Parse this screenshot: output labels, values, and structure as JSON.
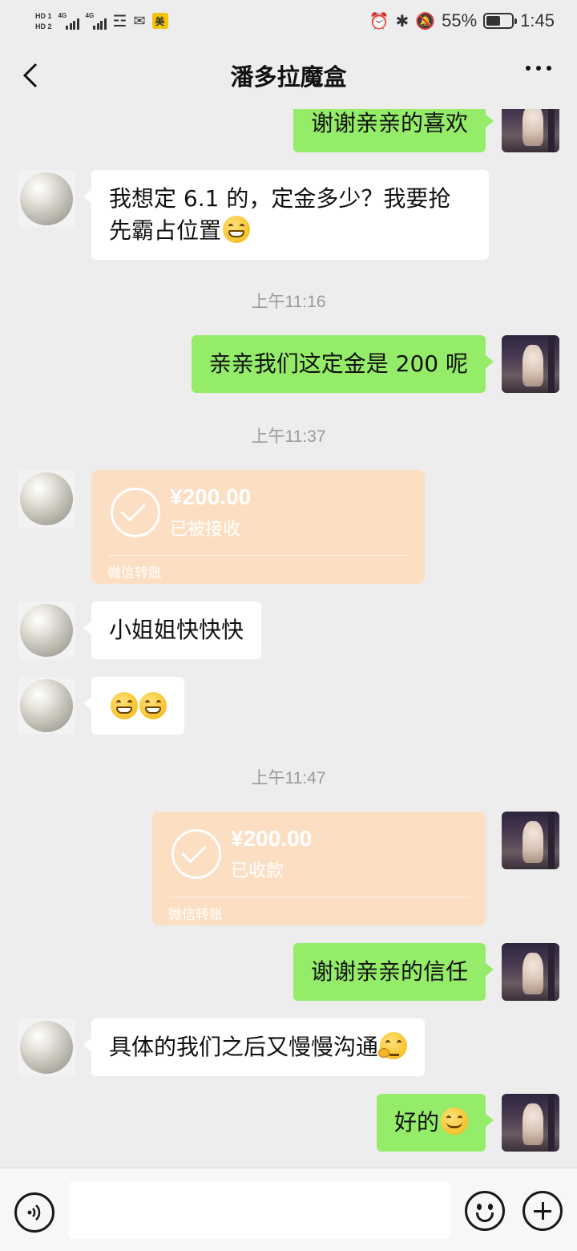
{
  "status_bar": {
    "hd1": "HD 1",
    "hd2": "HD 2",
    "net1": "4G",
    "net2": "4G",
    "app_badge": "美",
    "battery_percent": "55%",
    "battery_level": 0.55,
    "time": "1:45",
    "icons": [
      "alarm-icon",
      "bluetooth-icon",
      "mute-icon",
      "wifi-icon"
    ]
  },
  "header": {
    "title": "潘多拉魔盒"
  },
  "messages": {
    "m1": {
      "text": "谢谢亲亲的喜欢"
    },
    "m2": {
      "text": "我想定 6.1 的，定金多少？我要抢先霸占位置",
      "emoji": "grin-emoji"
    },
    "t1": "上午11:16",
    "m3": {
      "text": "亲亲我们这定金是 200 呢"
    },
    "t2": "上午11:37",
    "tr1": {
      "amount": "¥200.00",
      "status": "已被接收",
      "label": "微信转账"
    },
    "m4": {
      "text": "小姐姐快快快"
    },
    "m5": {
      "emojis": [
        "grin-emoji",
        "grin-emoji"
      ]
    },
    "t3": "上午11:47",
    "tr2": {
      "amount": "¥200.00",
      "status": "已收款",
      "label": "微信转账"
    },
    "m6": {
      "text": "谢谢亲亲的信任"
    },
    "m7": {
      "text": "具体的我们之后又慢慢沟通",
      "emoji": "thinking-emoji"
    },
    "m8": {
      "text": "好的",
      "emoji": "smile-emoji"
    }
  },
  "colors": {
    "background": "#ededed",
    "incoming_bubble": "#ffffff",
    "outgoing_bubble": "#95ec69",
    "transfer_card": "#fcdfc3",
    "timestamp": "#9a9a9a"
  }
}
